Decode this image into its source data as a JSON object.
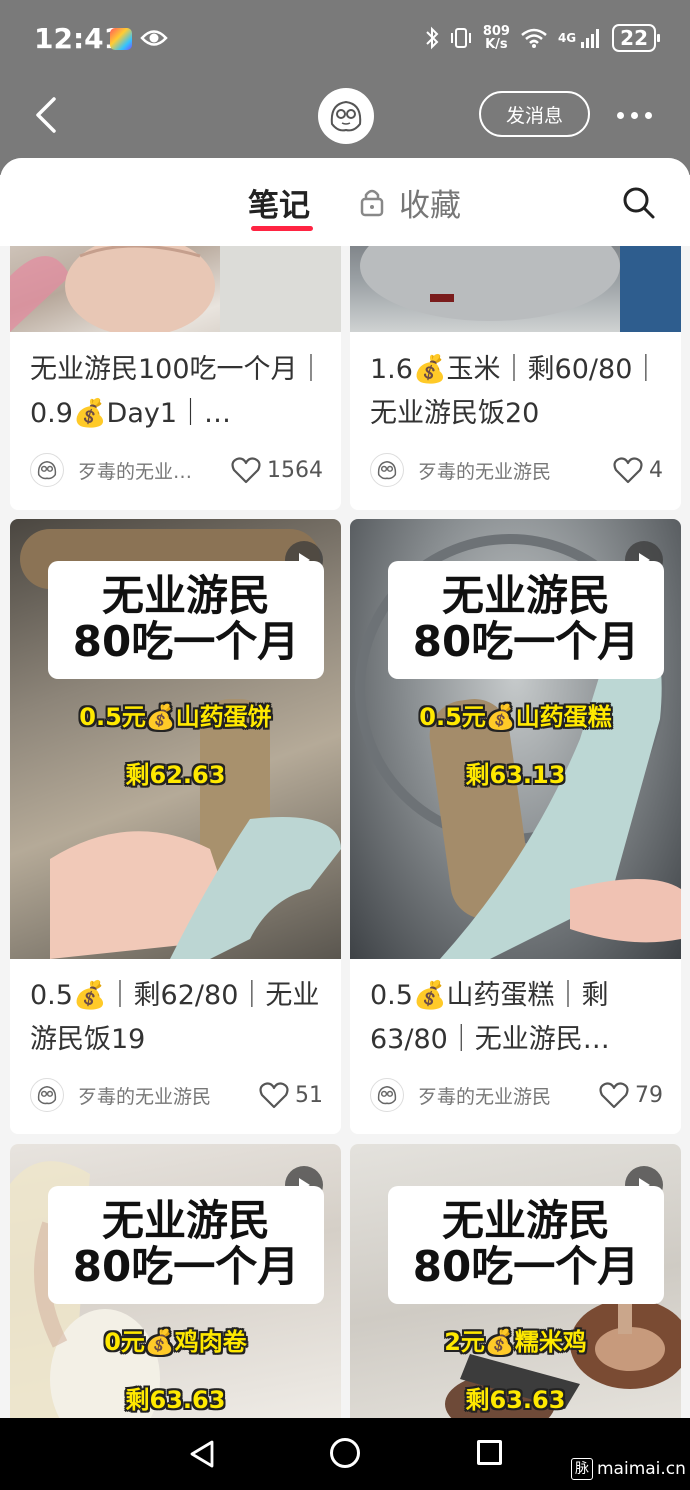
{
  "status_bar": {
    "time": "12:41",
    "net_speed_value": "809",
    "net_speed_unit": "K/s",
    "network": "4G",
    "battery": "22"
  },
  "header": {
    "message_button": "发消息"
  },
  "tabs": {
    "notes": "笔记",
    "favorites": "收藏"
  },
  "notes": [
    {
      "title": "无业游民100吃一个月｜0.9💰Day1｜…",
      "author": "歹毒的无业…",
      "likes": "1564"
    },
    {
      "title": "1.6💰玉米｜剩60/80｜无业游民饭20",
      "author": "歹毒的无业游民",
      "likes": "4"
    },
    {
      "overlay_title_1": "无业游民",
      "overlay_title_2": "80吃一个月",
      "overlay_dish": "0.5元💰山药蛋饼",
      "overlay_remain": "剩62.63",
      "title": "0.5💰｜剩62/80｜无业游民饭19",
      "author": "歹毒的无业游民",
      "likes": "51"
    },
    {
      "overlay_title_1": "无业游民",
      "overlay_title_2": "80吃一个月",
      "overlay_dish": "0.5元💰山药蛋糕",
      "overlay_remain": "剩63.13",
      "title": "0.5💰山药蛋糕｜剩63/80｜无业游民…",
      "author": "歹毒的无业游民",
      "likes": "79"
    },
    {
      "overlay_title_1": "无业游民",
      "overlay_title_2": "80吃一个月",
      "overlay_dish": "0元💰鸡肉卷",
      "overlay_remain": "剩63.63"
    },
    {
      "overlay_title_1": "无业游民",
      "overlay_title_2": "80吃一个月",
      "overlay_dish": "2元💰糯米鸡",
      "overlay_remain": "剩63.63"
    }
  ],
  "watermark": {
    "mark": "脉",
    "site": "maimai.cn"
  },
  "colors": {
    "accent": "#ff2442",
    "header_bg": "#7a7a7a",
    "overlay_text": "#ffe900"
  }
}
